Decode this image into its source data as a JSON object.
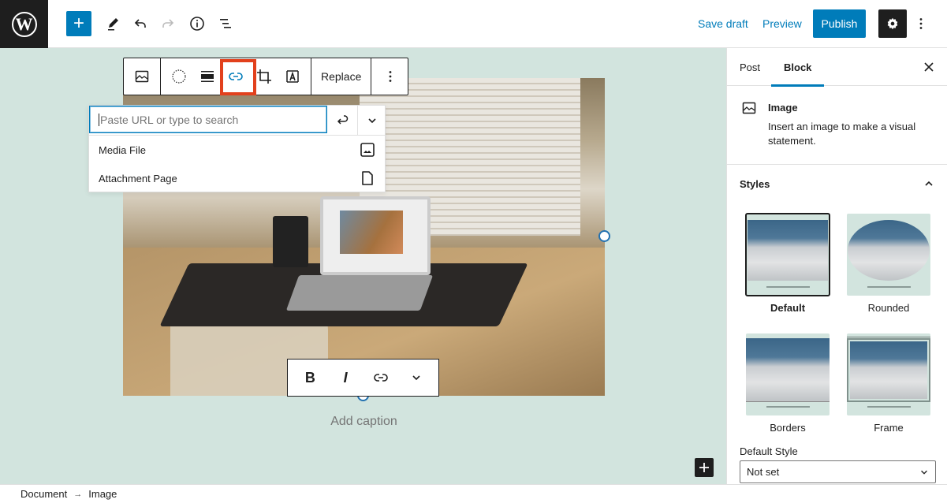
{
  "header": {
    "logo_label": "W",
    "add_block_label": "+",
    "save_draft_label": "Save draft",
    "preview_label": "Preview",
    "publish_label": "Publish",
    "icons": [
      "wordpress-logo",
      "add-block",
      "edit-tools",
      "undo",
      "redo",
      "info",
      "list-view",
      "settings-gear",
      "more-options"
    ]
  },
  "block_toolbar": {
    "replace_label": "Replace",
    "buttons": [
      "image-block-type",
      "duotone",
      "align",
      "link",
      "crop",
      "text-overlay",
      "replace",
      "more-options"
    ],
    "highlighted_button": "link"
  },
  "link_popover": {
    "placeholder": "Paste URL or type to search",
    "value": "",
    "suggestions": [
      {
        "label": "Media File",
        "icon": "image-icon"
      },
      {
        "label": "Attachment Page",
        "icon": "page-icon"
      }
    ]
  },
  "format_toolbar": {
    "bold_label": "B",
    "italic_label": "I"
  },
  "caption": {
    "placeholder": "Add caption"
  },
  "footer": {
    "breadcrumb": [
      "Document",
      "Image"
    ],
    "separator": "→"
  },
  "sidebar": {
    "tabs": [
      {
        "label": "Post",
        "active": false
      },
      {
        "label": "Block",
        "active": true
      }
    ],
    "block_card": {
      "title": "Image",
      "description": "Insert an image to make a visual statement."
    },
    "styles": {
      "heading": "Styles",
      "expanded": true,
      "options": [
        {
          "label": "Default",
          "selected": true
        },
        {
          "label": "Rounded",
          "selected": false
        },
        {
          "label": "Borders",
          "selected": false
        },
        {
          "label": "Frame",
          "selected": false
        }
      ]
    },
    "default_style": {
      "label": "Default Style",
      "value": "Not set"
    }
  },
  "colors": {
    "accent": "#007cba",
    "highlight_box": "#e2401c",
    "canvas_bg": "#d2e4de",
    "dark": "#1e1e1e"
  }
}
